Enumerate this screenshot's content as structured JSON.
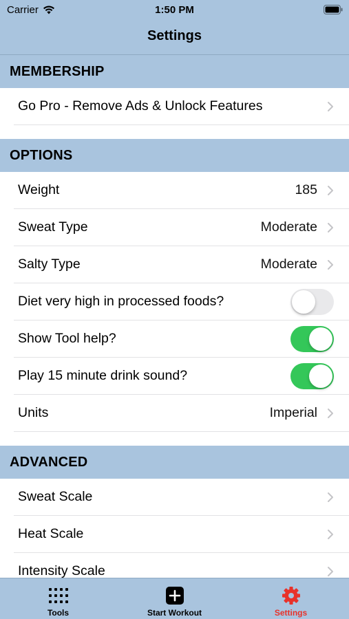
{
  "status_bar": {
    "carrier": "Carrier",
    "time": "1:50 PM"
  },
  "nav": {
    "title": "Settings"
  },
  "sections": {
    "membership": {
      "header": "MEMBERSHIP",
      "go_pro": "Go Pro - Remove Ads & Unlock Features"
    },
    "options": {
      "header": "OPTIONS",
      "weight": {
        "label": "Weight",
        "value": "185"
      },
      "sweat_type": {
        "label": "Sweat Type",
        "value": "Moderate"
      },
      "salty_type": {
        "label": "Salty Type",
        "value": "Moderate"
      },
      "processed_foods": {
        "label": "Diet very high in processed foods?",
        "on": false
      },
      "tool_help": {
        "label": "Show Tool help?",
        "on": true
      },
      "drink_sound": {
        "label": "Play 15 minute drink sound?",
        "on": true
      },
      "units": {
        "label": "Units",
        "value": "Imperial"
      }
    },
    "advanced": {
      "header": "ADVANCED",
      "sweat_scale": "Sweat Scale",
      "heat_scale": "Heat Scale",
      "intensity_scale": "Intensity Scale"
    }
  },
  "tabbar": {
    "tools": "Tools",
    "start_workout": "Start Workout",
    "settings": "Settings",
    "active_color": "#e8322a"
  },
  "colors": {
    "bar_bg": "#a9c4de",
    "toggle_on": "#34c759"
  }
}
